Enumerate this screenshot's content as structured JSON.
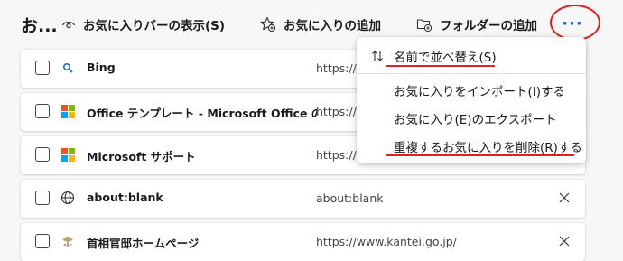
{
  "toolbar": {
    "title": "お...",
    "show_bar_label": "お気に入りバーの表示(S)",
    "add_favorite_label": "お気に入りの追加",
    "add_folder_label": "フォルダーの追加",
    "more_label": "···"
  },
  "menu": {
    "sort_by_name": "名前で並べ替え(S)",
    "import": "お気に入りをインポート(I)する",
    "export": "お気に入り(E)のエクスポート",
    "remove_duplicates": "重複するお気に入りを削除(R)する"
  },
  "rows": [
    {
      "name": "Bing",
      "url": "https://w",
      "icon": "search-icon"
    },
    {
      "name": "Office テンプレート - Microsoft Office のテ",
      "url": "https://w",
      "icon": "microsoft-logo-icon"
    },
    {
      "name": "Microsoft サポート",
      "url": "https://s",
      "icon": "microsoft-logo-icon"
    },
    {
      "name": "about:blank",
      "url": "about:blank",
      "icon": "globe-icon"
    },
    {
      "name": "首相官邸ホームページ",
      "url": "https://www.kantei.go.jp/",
      "icon": "kantei-logo-icon"
    }
  ],
  "colors": {
    "accent": "#0f6cbd",
    "annotation_red": "#e0201f"
  }
}
